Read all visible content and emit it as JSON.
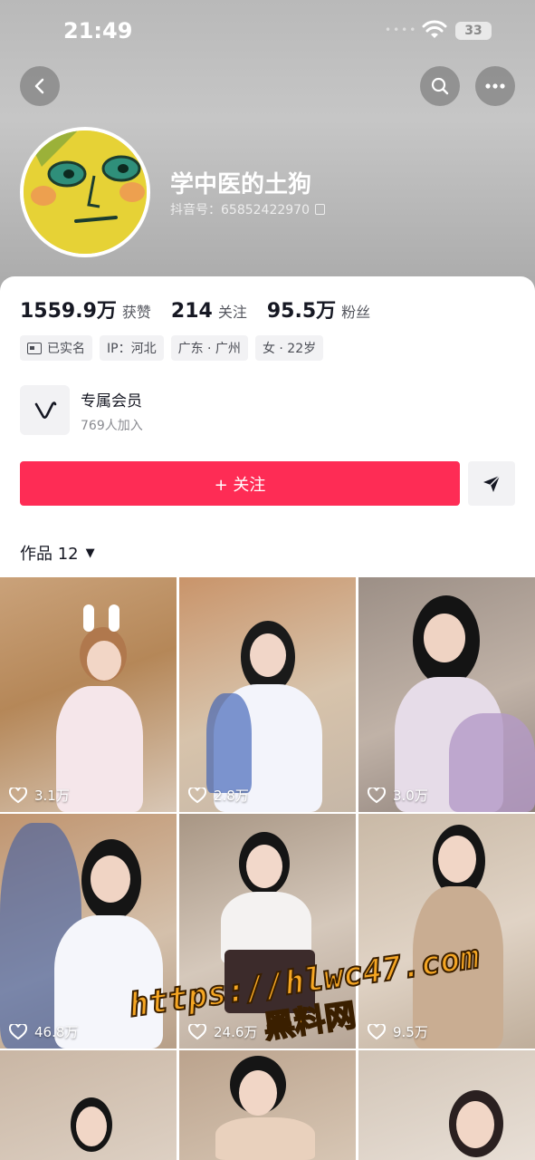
{
  "status_bar": {
    "time": "21:49",
    "battery": "33"
  },
  "profile": {
    "nickname": "学中医的土狗",
    "douyin_id": "抖音号：65852422970"
  },
  "stats": [
    {
      "value": "1559.9万",
      "label": "获赞"
    },
    {
      "value": "214",
      "label": "关注"
    },
    {
      "value": "95.5万",
      "label": "粉丝"
    }
  ],
  "tags": [
    "已实名",
    "IP：河北",
    "广东 · 广州",
    "女 · 22岁"
  ],
  "membership": {
    "title": "专属会员",
    "count": "769人加入"
  },
  "actions": {
    "follow_label": "+ 关注"
  },
  "works": {
    "tab_label": "作品 12"
  },
  "videos": [
    {
      "likes": "3.1万"
    },
    {
      "likes": "2.8万"
    },
    {
      "likes": "3.0万"
    },
    {
      "likes": "46.8万"
    },
    {
      "likes": "24.6万"
    },
    {
      "likes": "9.5万"
    },
    {
      "likes": ""
    },
    {
      "likes": ""
    },
    {
      "likes": ""
    }
  ],
  "watermark": {
    "url": "https://hlwc47.com",
    "sub": "黑料网"
  },
  "colors": {
    "accent": "#fe2c55",
    "watermark": "#f5a623"
  },
  "icons": [
    "back-icon",
    "search-icon",
    "more-icon",
    "copy-icon",
    "id-card-icon",
    "v-logo-icon",
    "send-icon",
    "heart-icon",
    "dropdown-caret-icon"
  ]
}
